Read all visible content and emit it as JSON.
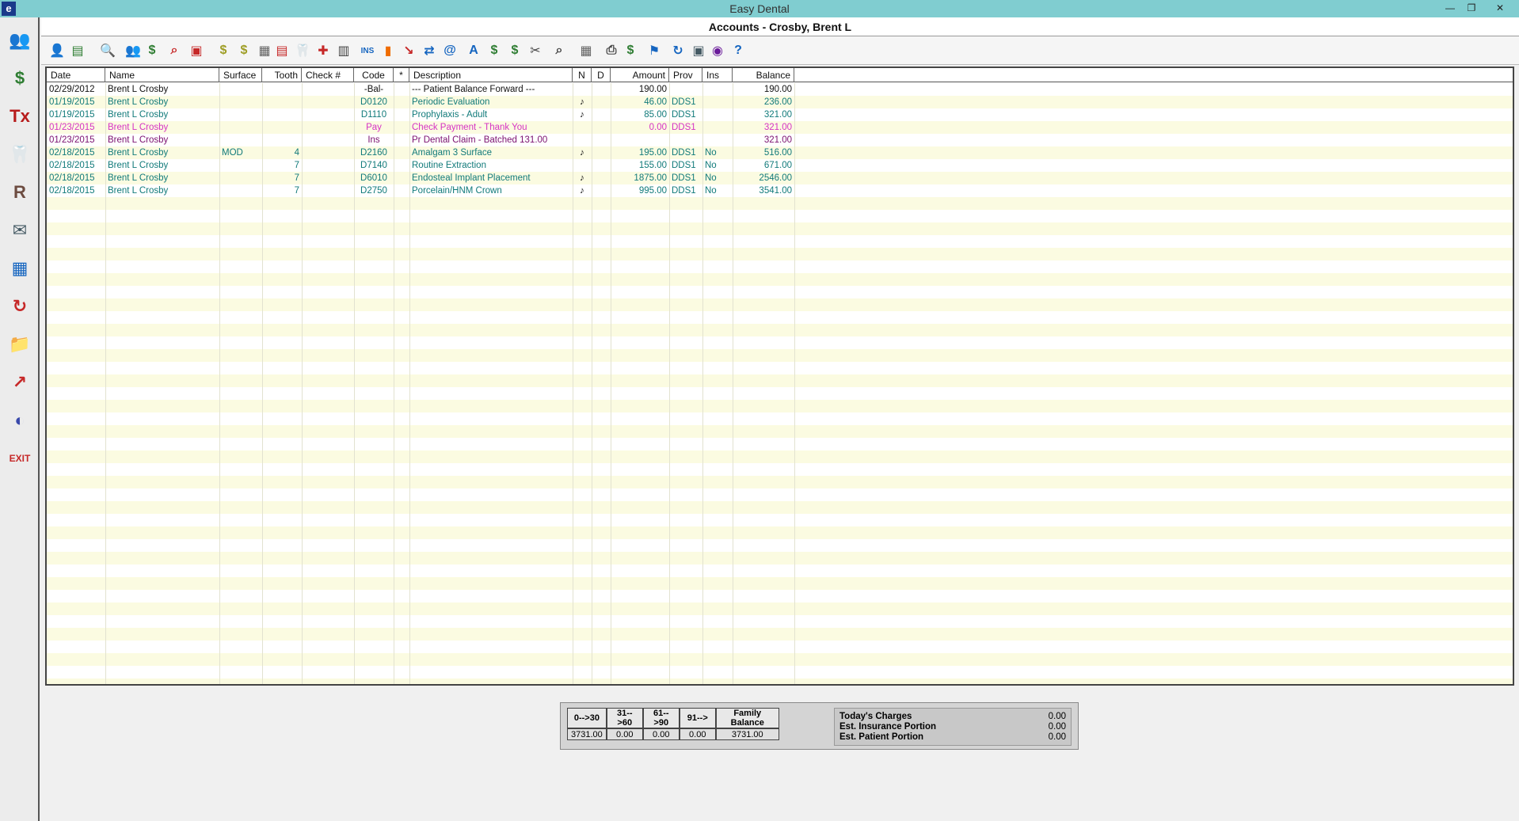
{
  "app": {
    "title": "Easy Dental",
    "icon_letter": "e"
  },
  "window": {
    "title": "Accounts - Crosby, Brent L"
  },
  "window_controls": [
    "minimize-icon",
    "restore-icon",
    "close-icon"
  ],
  "sidebar": {
    "items": [
      {
        "name": "family-file-icon",
        "glyph": "👥",
        "color": "#c62828"
      },
      {
        "name": "account-icon",
        "glyph": "$",
        "color": "#2e7d32"
      },
      {
        "name": "treatment-plan-icon",
        "glyph": "Tx",
        "color": "#b71c1c"
      },
      {
        "name": "chart-tooth-icon",
        "glyph": "🦷",
        "color": "#8d6e63"
      },
      {
        "name": "prescription-icon",
        "glyph": "R",
        "color": "#6d4c41"
      },
      {
        "name": "letters-icon",
        "glyph": "✉",
        "color": "#455a64"
      },
      {
        "name": "reports-icon",
        "glyph": "▦",
        "color": "#1565c0"
      },
      {
        "name": "recall-icon",
        "glyph": "↻",
        "color": "#c62828"
      },
      {
        "name": "documents-folder-icon",
        "glyph": "📁",
        "color": "#f9a825"
      },
      {
        "name": "analysis-icon",
        "glyph": "↗",
        "color": "#c62828"
      },
      {
        "name": "internet-icon",
        "glyph": "◐",
        "color": "#3949ab"
      },
      {
        "name": "exit-icon",
        "glyph": "EXIT",
        "color": "#c62828"
      }
    ]
  },
  "toolbar": {
    "buttons": [
      {
        "name": "select-patient-icon",
        "glyph": "👤",
        "color": "#c62828"
      },
      {
        "name": "account-info-icon",
        "glyph": "▤",
        "color": "#2e7d32"
      },
      {
        "name": "search-icon",
        "glyph": "🔍",
        "color": "#1565c0"
      },
      {
        "name": "family-icon",
        "glyph": "👥",
        "color": "#6a1b9a"
      },
      {
        "name": "payment-icon",
        "glyph": "$",
        "color": "#2e7d32"
      },
      {
        "name": "find-icon",
        "glyph": "⌕",
        "color": "#c62828"
      },
      {
        "name": "insurance-card-icon",
        "glyph": "▣",
        "color": "#c62828"
      },
      {
        "name": "enter-charge-icon",
        "glyph": "$",
        "color": "#9e9d24"
      },
      {
        "name": "enter-payment-icon",
        "glyph": "$",
        "color": "#9e9d24"
      },
      {
        "name": "calculator-icon",
        "glyph": "▦",
        "color": "#616161"
      },
      {
        "name": "statement-icon",
        "glyph": "▤",
        "color": "#c62828"
      },
      {
        "name": "codes-icon",
        "glyph": "🦷",
        "color": "#616161"
      },
      {
        "name": "medical-alert-icon",
        "glyph": "✚",
        "color": "#c62828"
      },
      {
        "name": "clipboard-icon",
        "glyph": "▥",
        "color": "#424242"
      },
      {
        "name": "insurance-icon",
        "glyph": "INS",
        "color": "#1565c0"
      },
      {
        "name": "bar-chart-icon",
        "glyph": "▮",
        "color": "#ef6c00"
      },
      {
        "name": "claim-icon",
        "glyph": "↘",
        "color": "#c62828"
      },
      {
        "name": "eclaim-icon",
        "glyph": "⇄",
        "color": "#1565c0"
      },
      {
        "name": "email-icon",
        "glyph": "@",
        "color": "#1565c0"
      },
      {
        "name": "text-icon",
        "glyph": "A",
        "color": "#1565c0"
      },
      {
        "name": "billing-icon",
        "glyph": "$",
        "color": "#2e7d32"
      },
      {
        "name": "finance-charge-icon",
        "glyph": "$",
        "color": "#2e7d32"
      },
      {
        "name": "tools-icon",
        "glyph": "✂",
        "color": "#424242"
      },
      {
        "name": "zoom-icon",
        "glyph": "⌕",
        "color": "#424242"
      },
      {
        "name": "calendar-icon",
        "glyph": "▦",
        "color": "#616161"
      },
      {
        "name": "print-icon",
        "glyph": "⎙",
        "color": "#424242"
      },
      {
        "name": "payment-plan-icon",
        "glyph": "$",
        "color": "#2e7d32"
      },
      {
        "name": "flag-icon",
        "glyph": "⚑",
        "color": "#1565c0"
      },
      {
        "name": "refresh-icon",
        "glyph": "↻",
        "color": "#1565c0"
      },
      {
        "name": "image-icon",
        "glyph": "▣",
        "color": "#455a64"
      },
      {
        "name": "web-icon",
        "glyph": "◉",
        "color": "#6a1b9a"
      },
      {
        "name": "help-icon",
        "glyph": "?",
        "color": "#1565c0"
      }
    ]
  },
  "grid": {
    "headers": [
      "Date",
      "Name",
      "Surface",
      "Tooth",
      "Check #",
      "Code",
      "*",
      "Description",
      "N",
      "D",
      "Amount",
      "Prov",
      "Ins",
      "Balance"
    ],
    "rows": [
      {
        "date": "02/29/2012",
        "name": "Brent L Crosby",
        "surface": "",
        "tooth": "",
        "check": "",
        "code": "-Bal-",
        "star": "",
        "description": "--- Patient Balance Forward ---",
        "n": "",
        "d": "",
        "amount": "190.00",
        "prov": "",
        "ins": "",
        "balance": "190.00",
        "color": "#111111"
      },
      {
        "date": "01/19/2015",
        "name": "Brent L Crosby",
        "surface": "",
        "tooth": "",
        "check": "",
        "code": "D0120",
        "star": "",
        "description": "Periodic Evaluation",
        "n": "♪",
        "d": "",
        "amount": "46.00",
        "prov": "DDS1",
        "ins": "",
        "balance": "236.00",
        "color": "#117a7a"
      },
      {
        "date": "01/19/2015",
        "name": "Brent L Crosby",
        "surface": "",
        "tooth": "",
        "check": "",
        "code": "D1110",
        "star": "",
        "description": "Prophylaxis - Adult",
        "n": "♪",
        "d": "",
        "amount": "85.00",
        "prov": "DDS1",
        "ins": "",
        "balance": "321.00",
        "color": "#117a7a"
      },
      {
        "date": "01/23/2015",
        "name": "Brent L Crosby",
        "surface": "",
        "tooth": "",
        "check": "",
        "code": "Pay",
        "star": "",
        "description": "Check Payment - Thank You",
        "n": "",
        "d": "",
        "amount": "0.00",
        "prov": "DDS1",
        "ins": "",
        "balance": "321.00",
        "color": "#d633c4"
      },
      {
        "date": "01/23/2015",
        "name": "Brent L Crosby",
        "surface": "",
        "tooth": "",
        "check": "",
        "code": "Ins",
        "star": "",
        "description": "Pr Dental Claim - Batched 131.00",
        "n": "",
        "d": "",
        "amount": "",
        "prov": "",
        "ins": "",
        "balance": "321.00",
        "color": "#7b1170"
      },
      {
        "date": "02/18/2015",
        "name": "Brent L Crosby",
        "surface": "MOD",
        "tooth": "4",
        "check": "",
        "code": "D2160",
        "star": "",
        "description": "Amalgam 3 Surface",
        "n": "♪",
        "d": "",
        "amount": "195.00",
        "prov": "DDS1",
        "ins": "No",
        "balance": "516.00",
        "color": "#117a7a"
      },
      {
        "date": "02/18/2015",
        "name": "Brent L Crosby",
        "surface": "",
        "tooth": "7",
        "check": "",
        "code": "D7140",
        "star": "",
        "description": "Routine Extraction",
        "n": "",
        "d": "",
        "amount": "155.00",
        "prov": "DDS1",
        "ins": "No",
        "balance": "671.00",
        "color": "#117a7a"
      },
      {
        "date": "02/18/2015",
        "name": "Brent L Crosby",
        "surface": "",
        "tooth": "7",
        "check": "",
        "code": "D6010",
        "star": "",
        "description": "Endosteal Implant Placement",
        "n": "♪",
        "d": "",
        "amount": "1875.00",
        "prov": "DDS1",
        "ins": "No",
        "balance": "2546.00",
        "color": "#117a7a"
      },
      {
        "date": "02/18/2015",
        "name": "Brent L Crosby",
        "surface": "",
        "tooth": "7",
        "check": "",
        "code": "D2750",
        "star": "",
        "description": "Porcelain/HNM Crown",
        "n": "♪",
        "d": "",
        "amount": "995.00",
        "prov": "DDS1",
        "ins": "No",
        "balance": "3541.00",
        "color": "#117a7a"
      }
    ]
  },
  "aging": {
    "headers": [
      "0-->30",
      "31-->60",
      "61-->90",
      "91-->",
      "Family Balance"
    ],
    "values": [
      "3731.00",
      "0.00",
      "0.00",
      "0.00",
      "3731.00"
    ]
  },
  "estimates": [
    {
      "label": "Today's Charges",
      "value": "0.00"
    },
    {
      "label": "Est. Insurance Portion",
      "value": "0.00"
    },
    {
      "label": "Est. Patient Portion",
      "value": "0.00"
    }
  ]
}
